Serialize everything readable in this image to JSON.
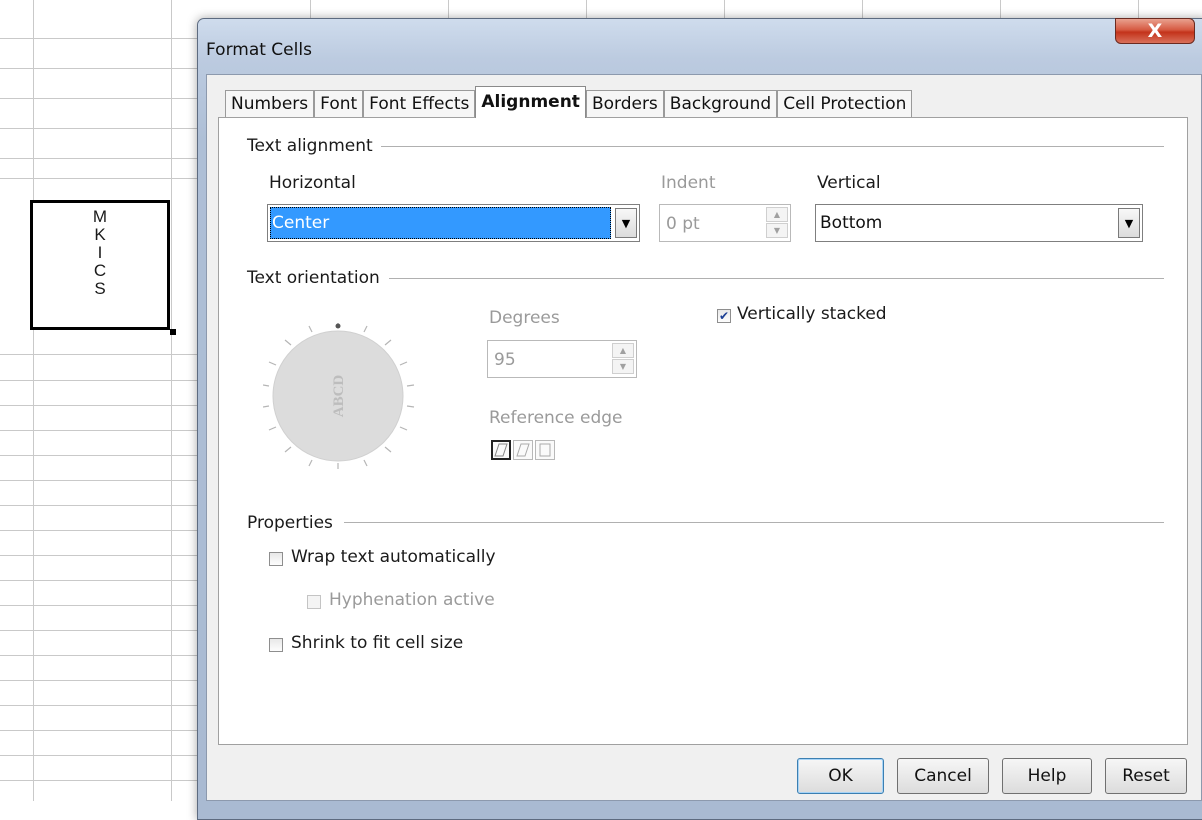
{
  "sheet": {
    "stacked_letters": [
      "M",
      "K",
      "I",
      "C",
      "S"
    ]
  },
  "dialog": {
    "title": "Format Cells",
    "close_label": "X",
    "tabs": [
      {
        "label": "Numbers",
        "active": false
      },
      {
        "label": "Font",
        "active": false
      },
      {
        "label": "Font Effects",
        "active": false
      },
      {
        "label": "Alignment",
        "active": true
      },
      {
        "label": "Borders",
        "active": false
      },
      {
        "label": "Background",
        "active": false
      },
      {
        "label": "Cell Protection",
        "active": false
      }
    ],
    "text_alignment": {
      "section": "Text alignment",
      "horizontal_label": "Horizontal",
      "horizontal_value": "Center",
      "indent_label": "Indent",
      "indent_value": "0 pt",
      "vertical_label": "Vertical",
      "vertical_value": "Bottom"
    },
    "text_orientation": {
      "section": "Text orientation",
      "dial_text": "ABCD",
      "degrees_label": "Degrees",
      "degrees_value": "95",
      "reference_edge_label": "Reference edge",
      "vertically_stacked_label": "Vertically stacked",
      "vertically_stacked_checked": true
    },
    "properties": {
      "section": "Properties",
      "wrap_label": "Wrap text automatically",
      "wrap_checked": false,
      "hyphenation_label": "Hyphenation active",
      "hyphenation_checked": false,
      "shrink_label": "Shrink to fit cell size",
      "shrink_checked": false
    },
    "buttons": {
      "ok": "OK",
      "cancel": "Cancel",
      "help": "Help",
      "reset": "Reset"
    }
  },
  "icons": {
    "close": "close-icon",
    "dropdown": "chevron-down-icon",
    "spin_up": "spin-up-icon",
    "spin_down": "spin-down-icon",
    "checkmark": "checkmark-icon"
  }
}
